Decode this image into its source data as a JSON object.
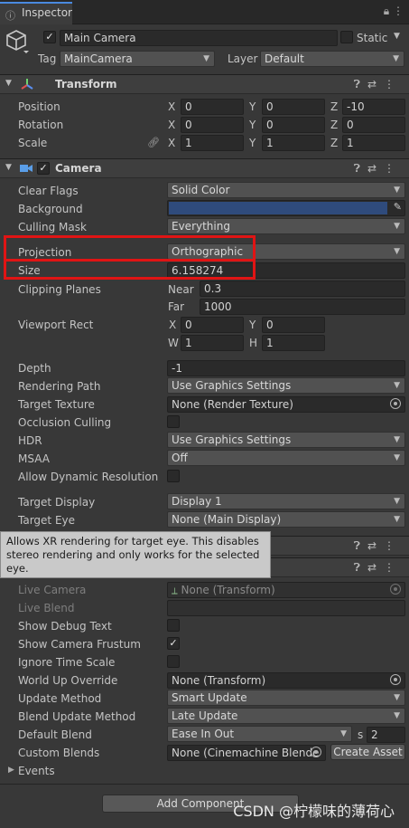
{
  "window": {
    "tab_title": "Inspector"
  },
  "object": {
    "active_checked": true,
    "name": "Main Camera",
    "static_label": "Static",
    "tag_label": "Tag",
    "tag_value": "MainCamera",
    "layer_label": "Layer",
    "layer_value": "Default"
  },
  "transform": {
    "title": "Transform",
    "position": {
      "label": "Position",
      "x": "0",
      "y": "0",
      "z": "-10"
    },
    "rotation": {
      "label": "Rotation",
      "x": "0",
      "y": "0",
      "z": "0"
    },
    "scale": {
      "label": "Scale",
      "x": "1",
      "y": "1",
      "z": "1"
    },
    "axes": {
      "x": "X",
      "y": "Y",
      "z": "Z"
    }
  },
  "camera": {
    "title": "Camera",
    "clear_flags": {
      "label": "Clear Flags",
      "value": "Solid Color"
    },
    "background": {
      "label": "Background",
      "color": "#2f4b7c"
    },
    "culling_mask": {
      "label": "Culling Mask",
      "value": "Everything"
    },
    "projection": {
      "label": "Projection",
      "value": "Orthographic"
    },
    "size": {
      "label": "Size",
      "value": "6.158274"
    },
    "clipping": {
      "label": "Clipping Planes",
      "near_label": "Near",
      "near": "0.3",
      "far_label": "Far",
      "far": "1000"
    },
    "viewport": {
      "label": "Viewport Rect",
      "x_label": "X",
      "x": "0",
      "y_label": "Y",
      "y": "0",
      "w_label": "W",
      "w": "1",
      "h_label": "H",
      "h": "1"
    },
    "depth": {
      "label": "Depth",
      "value": "-1"
    },
    "rendering_path": {
      "label": "Rendering Path",
      "value": "Use Graphics Settings"
    },
    "target_texture": {
      "label": "Target Texture",
      "value": "None (Render Texture)"
    },
    "occlusion_culling": {
      "label": "Occlusion Culling",
      "checked": false
    },
    "hdr": {
      "label": "HDR",
      "value": "Use Graphics Settings"
    },
    "msaa": {
      "label": "MSAA",
      "value": "Off"
    },
    "dynamic_resolution": {
      "label": "Allow Dynamic Resolution",
      "checked": false
    },
    "target_display": {
      "label": "Target Display",
      "value": "Display 1"
    },
    "target_eye": {
      "label": "Target Eye",
      "value": "None (Main Display)"
    }
  },
  "tooltip": {
    "text": "Allows XR rendering for target eye. This disables stereo rendering and only works for the selected eye."
  },
  "brain": {
    "live_camera": {
      "label": "Live Camera",
      "value": "None (Transform)"
    },
    "live_blend": {
      "label": "Live Blend",
      "value": ""
    },
    "show_debug_text": {
      "label": "Show Debug Text",
      "checked": false
    },
    "show_camera_frustum": {
      "label": "Show Camera Frustum",
      "checked": true
    },
    "ignore_time_scale": {
      "label": "Ignore Time Scale",
      "checked": false
    },
    "world_up_override": {
      "label": "World Up Override",
      "value": "None (Transform)"
    },
    "update_method": {
      "label": "Update Method",
      "value": "Smart Update"
    },
    "blend_update_method": {
      "label": "Blend Update Method",
      "value": "Late Update"
    },
    "default_blend": {
      "label": "Default Blend",
      "value": "Ease In Out",
      "s_label": "s",
      "s_value": "2"
    },
    "custom_blends": {
      "label": "Custom Blends",
      "value": "None (Cinemachine Blende",
      "create_asset": "Create Asset"
    },
    "events": {
      "label": "Events"
    }
  },
  "footer": {
    "add_component": "Add Component"
  },
  "watermark": "CSDN @柠檬味的薄荷心",
  "icons": {
    "lock": "lock-icon",
    "menu": "kebab-menu-icon",
    "help": "help-icon",
    "presets": "presets-icon"
  }
}
